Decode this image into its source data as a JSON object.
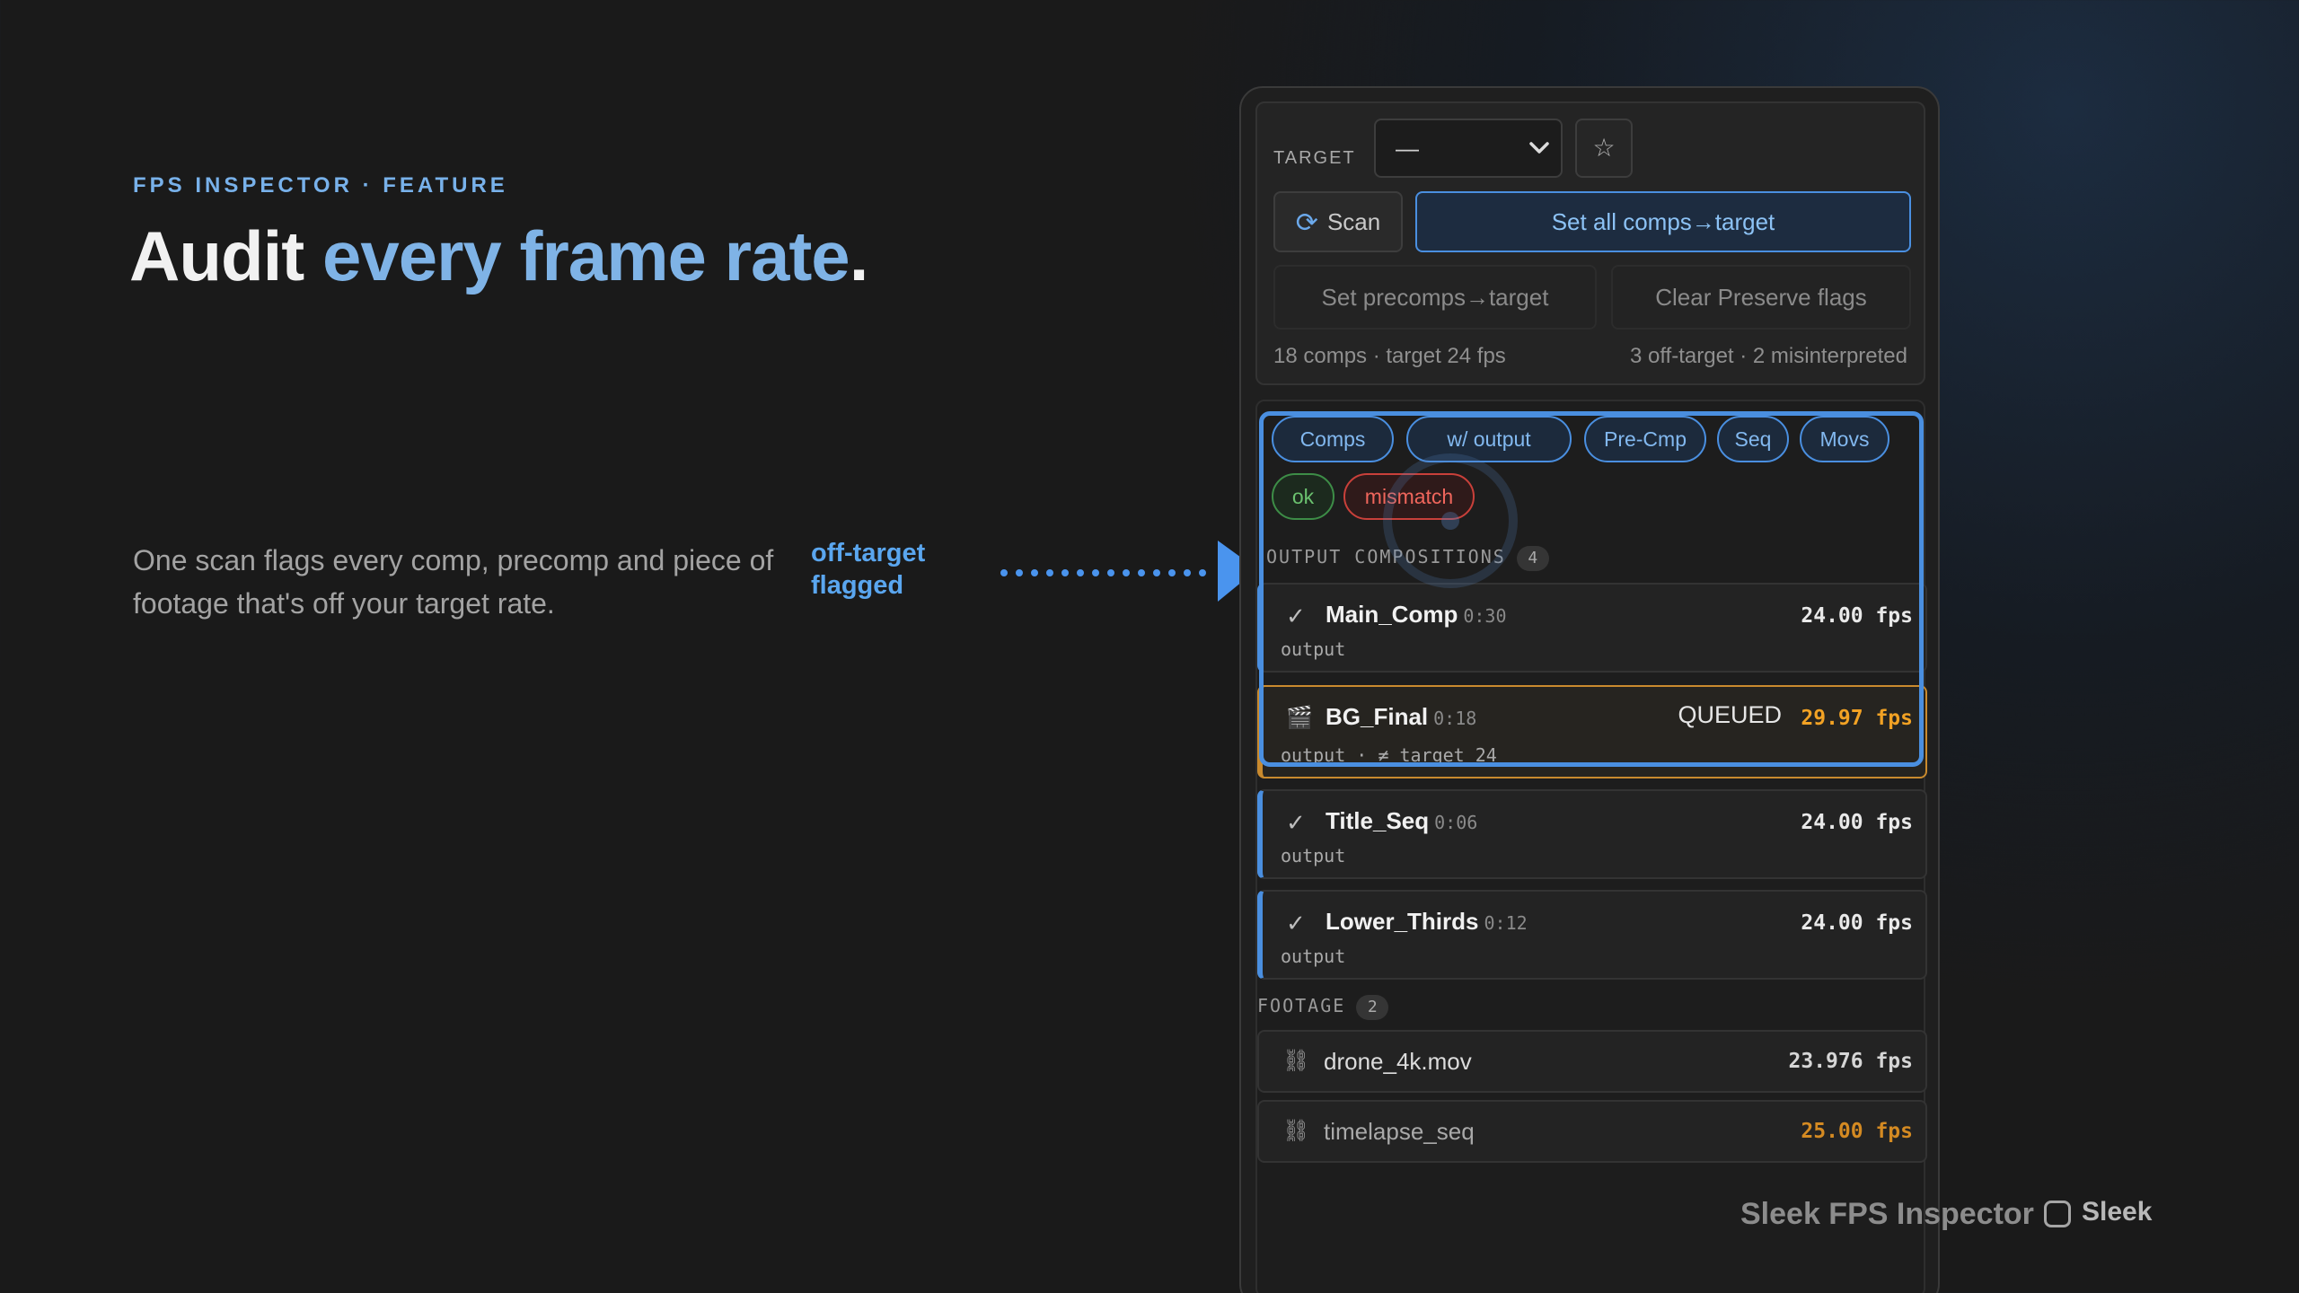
{
  "hero": {
    "eyebrow": "FPS INSPECTOR · FEATURE",
    "headline_plain": "Audit ",
    "headline_accent": "every frame rate",
    "headline_end": ".",
    "description": "One scan flags every comp, precomp and piece of footage that's off your target rate.",
    "callout_line1": "off-target",
    "callout_line2": "flagged"
  },
  "panel": {
    "target_label": "TARGET",
    "target_value": "—",
    "star_icon": "☆",
    "scan_label": "Scan",
    "set_all_label": "Set all comps→target",
    "set_precomps_label": "Set precomps→target",
    "clear_preserve_label": "Clear Preserve flags",
    "stats_left": "18 comps · target 24 fps",
    "stats_right": "3 off-target · 2 misinterpreted",
    "filters": [
      "Comps",
      "w/ output",
      "Pre-Cmp",
      "Seq",
      "Movs"
    ],
    "status_filters": {
      "ok": "ok",
      "mismatch": "mismatch"
    },
    "output_section": {
      "label": "OUTPUT COMPOSITIONS",
      "count": "4"
    },
    "comps": [
      {
        "name": "Main_Comp",
        "duration": "0:30",
        "sub": "output",
        "fps": "24.00 fps",
        "status": ""
      },
      {
        "name": "BG_Final",
        "duration": "0:18",
        "sub": "output · ≠ target 24",
        "fps": "29.97 fps",
        "status": "QUEUED"
      },
      {
        "name": "Title_Seq",
        "duration": "0:06",
        "sub": "output",
        "fps": "24.00 fps",
        "status": ""
      },
      {
        "name": "Lower_Thirds",
        "duration": "0:12",
        "sub": "output",
        "fps": "24.00 fps",
        "status": ""
      }
    ],
    "footage_section": {
      "label": "FOOTAGE",
      "count": "2"
    },
    "footage": [
      {
        "name": "drone_4k.mov",
        "fps": "23.976 fps"
      },
      {
        "name": "timelapse_seq",
        "fps": "25.00 fps"
      }
    ]
  },
  "footer": {
    "product_name": "Sleek FPS Inspector",
    "logo_text": "Sleek"
  },
  "colors": {
    "accent": "#4a8fe0",
    "warning": "#f2a224",
    "ok": "#6bc26f",
    "mismatch": "#f0665c"
  }
}
